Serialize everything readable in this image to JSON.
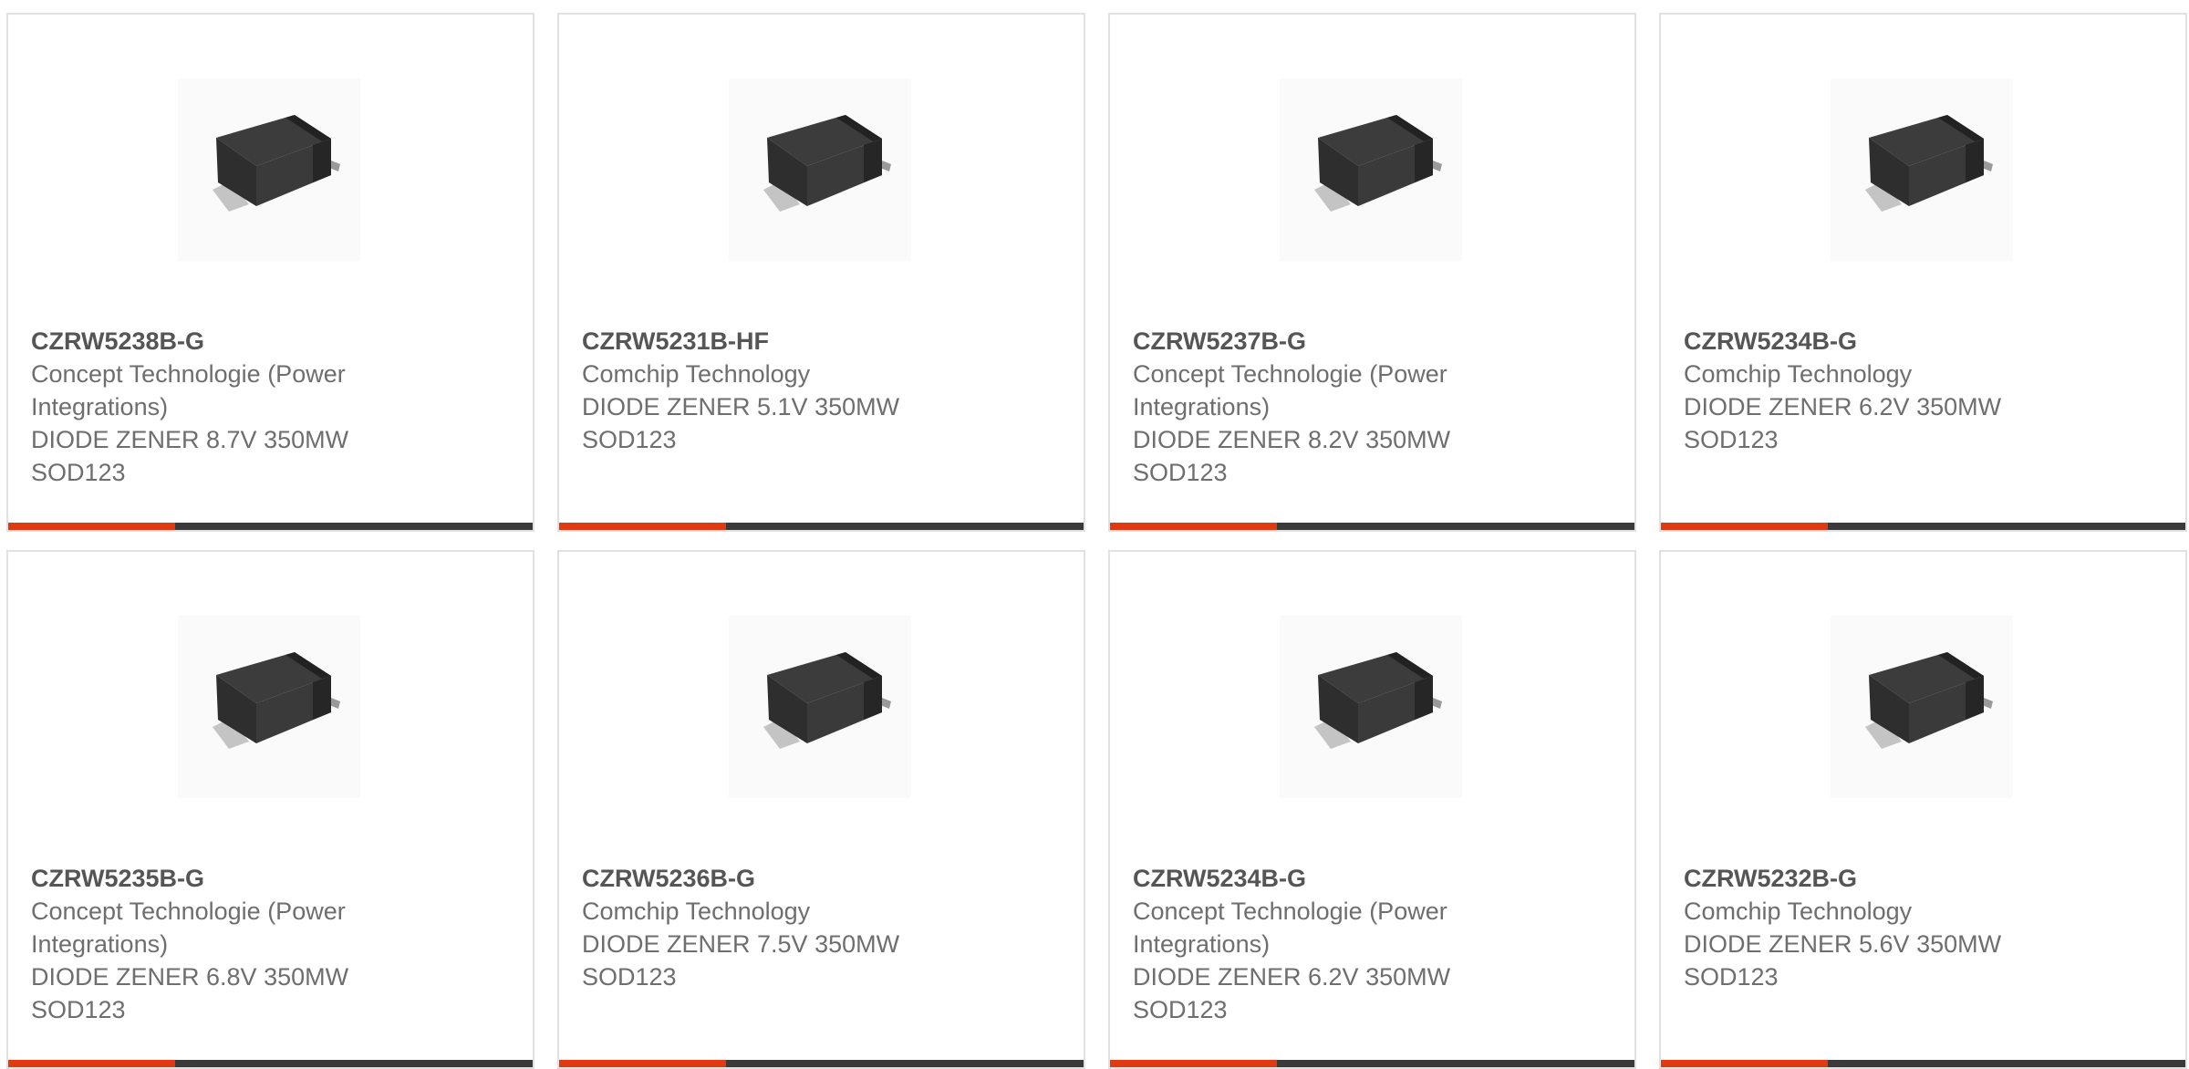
{
  "colors": {
    "accent": "#e23a10",
    "bar": "#3a3a3a",
    "card_border": "#e1e1e1",
    "text": "#6e6e6e"
  },
  "products": [
    {
      "part": "CZRW5238B-G",
      "manufacturer": "Concept Technologie (Power Integrations)",
      "description": "DIODE ZENER 8.7V 350MW SOD123",
      "image_icon": "sod123-package-image"
    },
    {
      "part": "CZRW5231B-HF",
      "manufacturer": "Comchip Technology",
      "description": "DIODE ZENER 5.1V 350MW SOD123",
      "image_icon": "sod123-package-image"
    },
    {
      "part": "CZRW5237B-G",
      "manufacturer": "Concept Technologie (Power Integrations)",
      "description": "DIODE ZENER 8.2V 350MW SOD123",
      "image_icon": "sod123-package-image"
    },
    {
      "part": "CZRW5234B-G",
      "manufacturer": "Comchip Technology",
      "description": "DIODE ZENER 6.2V 350MW SOD123",
      "image_icon": "sod123-package-image"
    },
    {
      "part": "CZRW5235B-G",
      "manufacturer": "Concept Technologie (Power Integrations)",
      "description": "DIODE ZENER 6.8V 350MW SOD123",
      "image_icon": "sod123-package-image"
    },
    {
      "part": "CZRW5236B-G",
      "manufacturer": "Comchip Technology",
      "description": "DIODE ZENER 7.5V 350MW SOD123",
      "image_icon": "sod123-package-image"
    },
    {
      "part": "CZRW5234B-G",
      "manufacturer": "Concept Technologie (Power Integrations)",
      "description": "DIODE ZENER 6.2V 350MW SOD123",
      "image_icon": "sod123-package-image"
    },
    {
      "part": "CZRW5232B-G",
      "manufacturer": "Comchip Technology",
      "description": "DIODE ZENER 5.6V 350MW SOD123",
      "image_icon": "sod123-package-image"
    }
  ]
}
